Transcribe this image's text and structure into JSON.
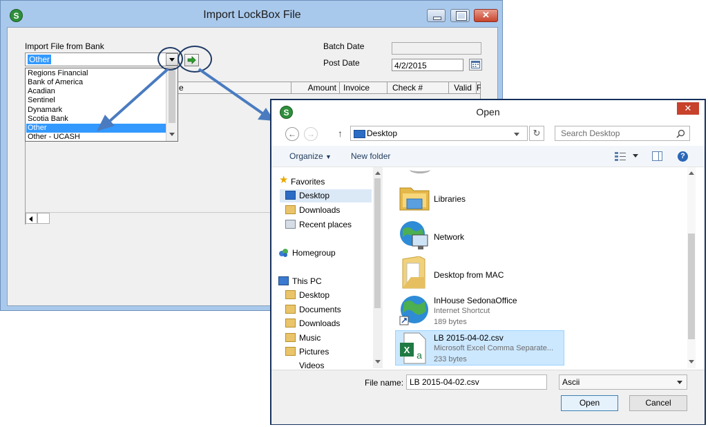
{
  "lockbox_window": {
    "app_icon": "S",
    "title": "Import LockBox File",
    "import_label": "Import File from Bank",
    "selected_bank": "Other",
    "batch_date_label": "Batch Date",
    "post_date_label": "Post Date",
    "post_date_value": "4/2/2015",
    "grid_headers": [
      "Amount",
      "Invoice",
      "Check #",
      "Valid"
    ],
    "grid_partial_header": "e",
    "grid_last_header": "F",
    "bank_options": [
      "Regions Financial",
      "Bank of America",
      "Acadian",
      "Sentinel",
      "Dynamark",
      "Scotia Bank",
      "Other",
      "Other - UCASH"
    ],
    "selected_index": 6
  },
  "open_dialog": {
    "app_icon": "S",
    "title": "Open",
    "close_glyph": "✕",
    "address_location": "Desktop",
    "search_placeholder": "Search Desktop",
    "organize_label": "Organize",
    "new_folder_label": "New folder",
    "nav": {
      "favorites_label": "Favorites",
      "favorites_items": [
        "Desktop",
        "Downloads",
        "Recent places"
      ],
      "homegroup_label": "Homegroup",
      "this_pc_label": "This PC",
      "this_pc_items": [
        "Desktop",
        "Documents",
        "Downloads",
        "Music",
        "Pictures",
        "Videos"
      ]
    },
    "files": [
      {
        "name": "Libraries",
        "line2": "",
        "line3": ""
      },
      {
        "name": "Network",
        "line2": "",
        "line3": ""
      },
      {
        "name": "Desktop from MAC",
        "line2": "",
        "line3": ""
      },
      {
        "name": "InHouse SedonaOffice",
        "line2": "Internet Shortcut",
        "line3": "189 bytes"
      },
      {
        "name": "LB 2015-04-02.csv",
        "line2": "Microsoft Excel Comma Separate...",
        "line3": "233 bytes"
      }
    ],
    "file_name_label": "File name:",
    "file_name_value": "LB 2015-04-02.csv",
    "file_type_value": "Ascii",
    "open_button": "Open",
    "cancel_button": "Cancel"
  },
  "colors": {
    "window_frame": "#a9c9ec",
    "selection": "#3399ff",
    "dialog_border": "#15305b",
    "annotation_arrow": "#4a7bc0",
    "close_red": "#c7412b"
  }
}
